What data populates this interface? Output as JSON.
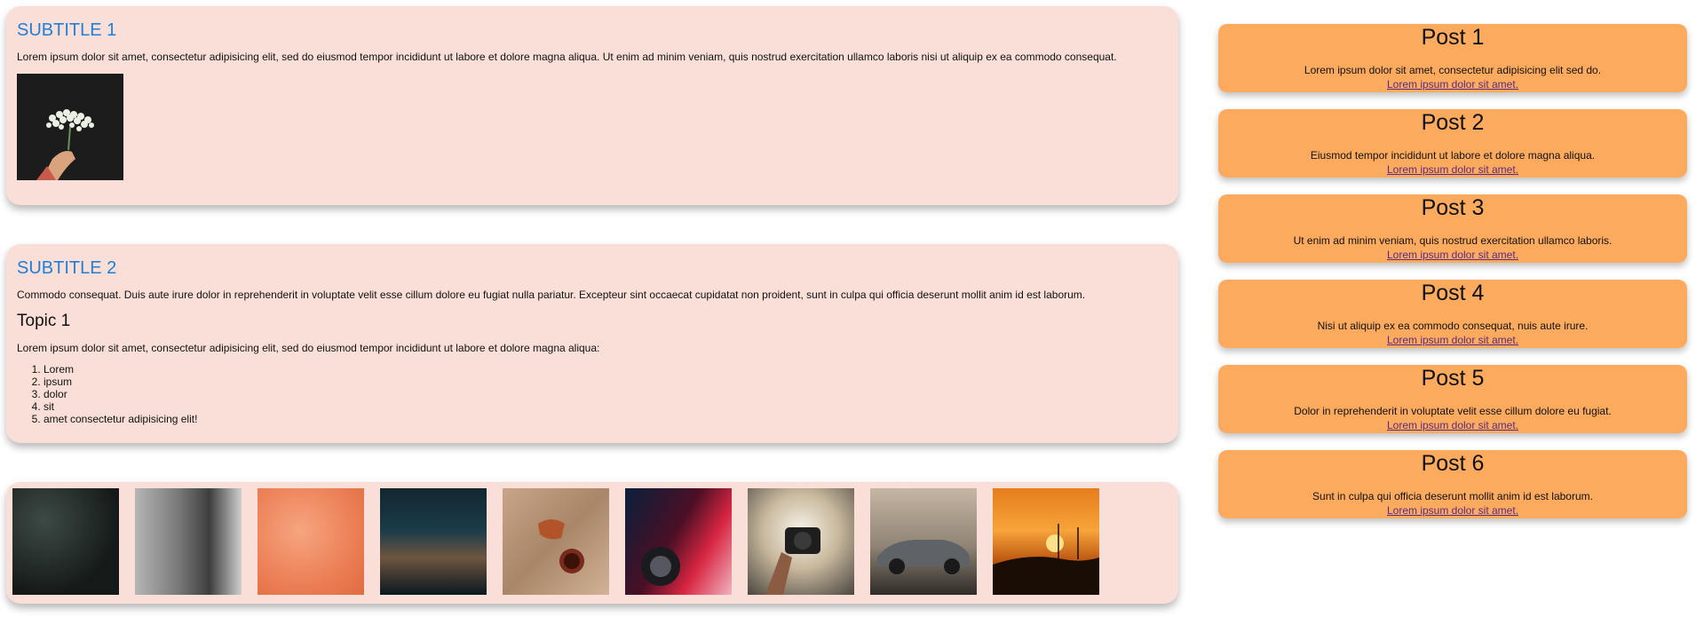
{
  "section1": {
    "subtitle": "SUBTITLE 1",
    "text": "Lorem ipsum dolor sit amet, consectetur adipisicing elit, sed do eiusmod tempor incididunt ut labore et dolore magna aliqua. Ut enim ad minim veniam, quis nostrud exercitation ullamco laboris nisi ut aliquip ex ea commodo consequat."
  },
  "section2": {
    "subtitle": "SUBTITLE 2",
    "text": "Commodo consequat. Duis aute irure dolor in reprehenderit in voluptate velit esse cillum dolore eu fugiat nulla pariatur. Excepteur sint occaecat cupidatat non proident, sunt in culpa qui officia deserunt mollit anim id est laborum.",
    "topic": "Topic 1",
    "topic_text": "Lorem ipsum dolor sit amet, consectetur adipisicing elit, sed do eiusmod tempor incididunt ut labore et dolore magna aliqua:",
    "list": [
      "Lorem",
      "ipsum",
      "dolor",
      "sit",
      "amet consectetur adipisicing elit!"
    ]
  },
  "posts": [
    {
      "title": "Post 1",
      "text": "Lorem ipsum dolor sit amet, consectetur adipisicing elit sed do.",
      "link": "Lorem ipsum dolor sit amet."
    },
    {
      "title": "Post 2",
      "text": "Eiusmod tempor incididunt ut labore et dolore magna aliqua.",
      "link": "Lorem ipsum dolor sit amet."
    },
    {
      "title": "Post 3",
      "text": "Ut enim ad minim veniam, quis nostrud exercitation ullamco laboris.",
      "link": "Lorem ipsum dolor sit amet."
    },
    {
      "title": "Post 4",
      "text": "Nisi ut aliquip ex ea commodo consequat, nuis aute irure.",
      "link": "Lorem ipsum dolor sit amet."
    },
    {
      "title": "Post 5",
      "text": "Dolor in reprehenderit in voluptate velit esse cillum dolore eu fugiat.",
      "link": "Lorem ipsum dolor sit amet."
    },
    {
      "title": "Post 6",
      "text": "Sunt in culpa qui officia deserunt mollit anim id est laborum.",
      "link": "Lorem ipsum dolor sit amet."
    }
  ],
  "colors": {
    "card_bg": "#f9dfd7",
    "subtitle": "#1f7fd8",
    "post_bg": "#fbaa5e",
    "link": "#5d2a83"
  }
}
